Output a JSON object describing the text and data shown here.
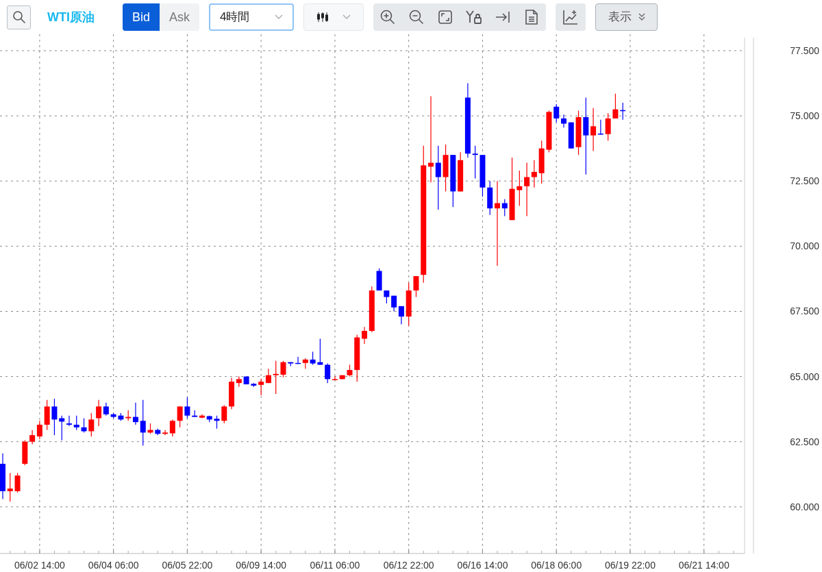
{
  "toolbar": {
    "symbol": "WTI原油",
    "price_sides": [
      {
        "label": "Bid",
        "selected": true
      },
      {
        "label": "Ask",
        "selected": false
      }
    ],
    "timeframe": {
      "value": "4時間"
    },
    "display_menu": {
      "label": "表示"
    }
  },
  "chart": {
    "chart_data": {
      "type": "candlestick",
      "grid": true,
      "ylim": [
        58.42,
        78.13
      ],
      "categories": [
        null,
        null,
        null,
        null,
        null,
        "06/02 14:00",
        null,
        null,
        null,
        null,
        null,
        null,
        null,
        null,
        null,
        "06/04 06:00",
        null,
        null,
        null,
        null,
        null,
        null,
        null,
        null,
        null,
        "06/05 22:00",
        null,
        null,
        null,
        null,
        null,
        null,
        null,
        null,
        null,
        "06/09 14:00",
        null,
        null,
        null,
        null,
        null,
        null,
        null,
        null,
        null,
        "06/11 06:00",
        null,
        null,
        null,
        null,
        null,
        null,
        null,
        null,
        null,
        "06/12 22:00",
        null,
        null,
        null,
        null,
        null,
        null,
        null,
        null,
        null,
        "06/16 14:00",
        null,
        null,
        null,
        null,
        null,
        null,
        null,
        null,
        null,
        "06/18 06:00",
        null,
        null,
        null,
        null,
        null,
        null,
        null,
        null,
        null,
        "06/19 22:00",
        null,
        null,
        null,
        null,
        null,
        null,
        null,
        null,
        null,
        "06/21 14:00",
        null,
        null,
        null,
        null,
        null
      ],
      "yticks": [
        {
          "value": 77.5,
          "label": "77.500"
        },
        {
          "value": 75,
          "label": "75.000"
        },
        {
          "value": 72.5,
          "label": "72.500"
        },
        {
          "value": 70,
          "label": "70.000"
        },
        {
          "value": 67.5,
          "label": "67.500"
        },
        {
          "value": 65,
          "label": "65.000"
        },
        {
          "value": 62.5,
          "label": "62.500"
        },
        {
          "value": 60,
          "label": "60.000"
        }
      ],
      "ohlc": [
        [
          61.65,
          62.05,
          60.3,
          60.6
        ],
        [
          60.6,
          61.3,
          60.2,
          60.7
        ],
        [
          60.6,
          61.3,
          60.55,
          61.2
        ],
        [
          61.65,
          62.55,
          61.6,
          62.5
        ],
        [
          62.5,
          62.95,
          62.4,
          62.75
        ],
        [
          62.7,
          63.3,
          62.6,
          63.15
        ],
        [
          63.15,
          64.1,
          62.95,
          63.85
        ],
        [
          63.85,
          64.15,
          62.75,
          63.35
        ],
        [
          63.4,
          63.5,
          62.55,
          63.27
        ],
        [
          63.2,
          63.5,
          63.1,
          63.15
        ],
        [
          63.15,
          63.5,
          62.95,
          63.05
        ],
        [
          63.05,
          63.4,
          62.85,
          62.9
        ],
        [
          62.9,
          63.6,
          62.7,
          63.35
        ],
        [
          63.4,
          64.1,
          63.1,
          63.85
        ],
        [
          63.85,
          64.0,
          63.5,
          63.55
        ],
        [
          63.55,
          63.6,
          63.4,
          63.45
        ],
        [
          63.5,
          63.6,
          63.3,
          63.35
        ],
        [
          63.4,
          63.7,
          63.3,
          63.45
        ],
        [
          63.45,
          64.0,
          63.15,
          63.25
        ],
        [
          63.3,
          64.1,
          62.35,
          62.85
        ],
        [
          62.85,
          63.2,
          62.8,
          62.95
        ],
        [
          62.95,
          63.0,
          62.75,
          62.8
        ],
        [
          62.8,
          62.95,
          62.75,
          62.85
        ],
        [
          62.82,
          63.35,
          62.7,
          63.3
        ],
        [
          63.3,
          63.85,
          63.05,
          63.85
        ],
        [
          63.85,
          64.2,
          63.4,
          63.5
        ],
        [
          63.5,
          63.7,
          63.45,
          63.45
        ],
        [
          63.42,
          63.55,
          63.4,
          63.5
        ],
        [
          63.48,
          63.5,
          63.25,
          63.35
        ],
        [
          63.38,
          63.5,
          63.0,
          63.3
        ],
        [
          63.3,
          63.9,
          63.2,
          63.85
        ],
        [
          63.85,
          64.95,
          63.75,
          64.8
        ],
        [
          64.75,
          65.0,
          64.6,
          64.9
        ],
        [
          65.0,
          65.0,
          64.7,
          64.7
        ],
        [
          64.72,
          64.75,
          64.6,
          64.65
        ],
        [
          64.68,
          64.92,
          64.28,
          64.8
        ],
        [
          64.75,
          65.3,
          64.75,
          65.05
        ],
        [
          65.05,
          65.6,
          64.33,
          65.1
        ],
        [
          65.07,
          65.6,
          64.97,
          65.55
        ],
        [
          65.55,
          65.55,
          65.4,
          65.5
        ],
        [
          65.52,
          65.75,
          65.5,
          65.5
        ],
        [
          65.52,
          65.7,
          65.3,
          65.65
        ],
        [
          65.65,
          65.95,
          65.45,
          65.5
        ],
        [
          65.55,
          66.45,
          65.45,
          65.45
        ],
        [
          65.45,
          65.5,
          64.75,
          64.9
        ],
        [
          64.88,
          65.0,
          64.85,
          64.9
        ],
        [
          64.9,
          65.05,
          64.9,
          65.05
        ],
        [
          65.05,
          65.45,
          65.0,
          65.25
        ],
        [
          65.25,
          66.6,
          64.8,
          66.5
        ],
        [
          66.45,
          66.9,
          66.25,
          66.75
        ],
        [
          66.75,
          68.45,
          66.7,
          68.3
        ],
        [
          69.05,
          69.15,
          68.3,
          68.3
        ],
        [
          68.3,
          68.3,
          67.8,
          68.05
        ],
        [
          68.1,
          68.1,
          67.5,
          67.65
        ],
        [
          67.7,
          67.7,
          67.0,
          67.3
        ],
        [
          67.3,
          68.6,
          66.95,
          68.3
        ],
        [
          68.3,
          68.85,
          68.05,
          68.85
        ],
        [
          68.9,
          73.85,
          68.6,
          73.1
        ],
        [
          73.05,
          75.75,
          72.45,
          73.2
        ],
        [
          73.2,
          73.85,
          71.4,
          72.65
        ],
        [
          72.65,
          73.9,
          72.1,
          73.5
        ],
        [
          73.5,
          73.5,
          71.5,
          72.1
        ],
        [
          72.1,
          73.6,
          72.1,
          73.3
        ],
        [
          75.7,
          76.25,
          73.4,
          73.55
        ],
        [
          73.55,
          73.85,
          72.6,
          73.5
        ],
        [
          73.5,
          73.5,
          71.9,
          72.25
        ],
        [
          72.25,
          72.5,
          71.2,
          71.45
        ],
        [
          71.45,
          72.5,
          69.25,
          71.65
        ],
        [
          71.65,
          71.8,
          71.15,
          71.45
        ],
        [
          71.0,
          73.4,
          71.0,
          72.2
        ],
        [
          72.15,
          72.9,
          71.55,
          72.3
        ],
        [
          72.3,
          73.2,
          71.15,
          72.65
        ],
        [
          72.65,
          73.3,
          72.25,
          72.85
        ],
        [
          72.8,
          74.05,
          72.4,
          73.75
        ],
        [
          73.7,
          75.2,
          73.6,
          75.15
        ],
        [
          75.35,
          75.45,
          74.75,
          74.9
        ],
        [
          74.9,
          75.05,
          74.55,
          74.7
        ],
        [
          74.75,
          74.75,
          73.75,
          73.75
        ],
        [
          73.8,
          75.2,
          73.5,
          74.95
        ],
        [
          74.95,
          75.7,
          72.75,
          74.25
        ],
        [
          74.25,
          75.3,
          73.65,
          74.6
        ],
        [
          74.32,
          74.85,
          74.28,
          74.28
        ],
        [
          74.3,
          75.1,
          74.05,
          74.9
        ],
        [
          74.9,
          75.85,
          74.9,
          75.25
        ],
        [
          75.22,
          75.5,
          74.85,
          75.18
        ],
        null,
        null,
        null,
        null,
        null,
        null,
        null,
        null,
        null,
        null,
        null,
        null,
        null,
        null,
        null,
        null
      ]
    }
  }
}
